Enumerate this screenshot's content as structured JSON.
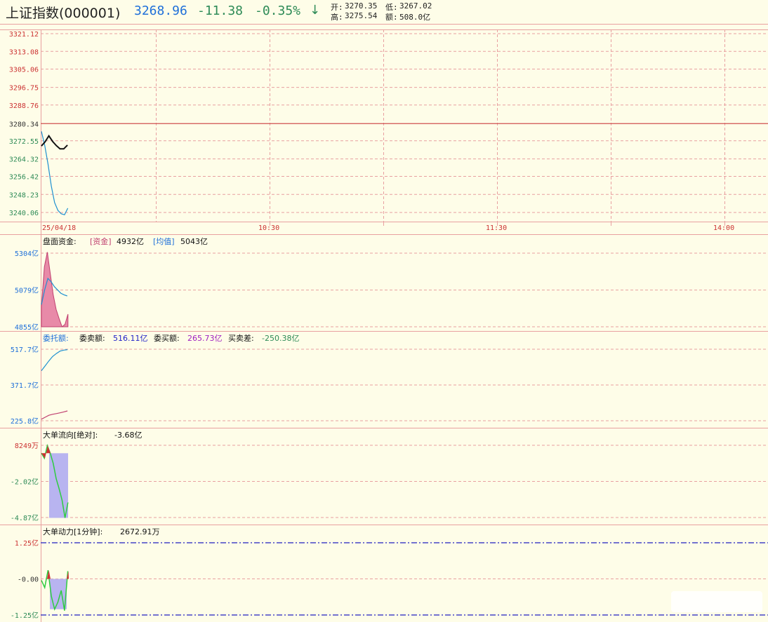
{
  "header": {
    "title": "上证指数(000001)",
    "price": "3268.96",
    "change": "-11.38",
    "change_pct": "-0.35%",
    "open_label": "开:",
    "open_value": "3270.35",
    "low_label": "低:",
    "low_value": "3267.02",
    "high_label": "高:",
    "high_value": "3275.54",
    "amount_label": "额:",
    "amount_value": "508.0亿"
  },
  "colors": {
    "up": "#cc3333",
    "down": "#2e8b57",
    "price_blue": "#1e6fd9",
    "grid": "#e8a0a0",
    "bg": "#fefde8"
  },
  "time_axis": {
    "labels": [
      "25/04/18",
      "10:30",
      "11:30",
      "14:00"
    ]
  },
  "panels": {
    "price": {
      "y_labels": [
        "3321.12",
        "3313.08",
        "3305.06",
        "3296.75",
        "3288.76",
        "3280.34",
        "3272.55",
        "3264.32",
        "3256.42",
        "3248.23",
        "3240.06"
      ],
      "prev_close": 3280.34
    },
    "capital": {
      "title": "盘面资金:",
      "fund_label": "[资金]",
      "fund_value": "4932亿",
      "avg_label": "[均值]",
      "avg_value": "5043亿",
      "y_labels": [
        "5304亿",
        "5079亿",
        "4855亿"
      ]
    },
    "orders": {
      "title": "委托额:",
      "sell_label": "委卖额:",
      "sell_value": "516.11亿",
      "buy_label": "委买额:",
      "buy_value": "265.73亿",
      "diff_label": "买卖差:",
      "diff_value": "-250.38亿",
      "y_labels": [
        "517.7亿",
        "371.7亿",
        "225.8亿"
      ]
    },
    "bigflow": {
      "title": "大单流向[绝对]:",
      "value": "-3.68亿",
      "y_labels": [
        "8249万",
        "-2.02亿",
        "-4.87亿"
      ]
    },
    "bigpower": {
      "title": "大单动力[1分钟]:",
      "value": "2672.91万",
      "y_labels": [
        "1.25亿",
        "-0.00",
        "-1.25亿"
      ]
    }
  },
  "chart_data": [
    {
      "type": "line",
      "title": "上证指数(000001)",
      "y_ticks": [
        3321.12,
        3313.08,
        3305.06,
        3296.75,
        3288.76,
        3280.34,
        3272.55,
        3264.32,
        3256.42,
        3248.23,
        3240.06
      ],
      "ylim": [
        3240.06,
        3321.12
      ],
      "x_labels": [
        "25/04/18",
        "10:30",
        "11:30",
        "14:00"
      ],
      "series": [
        {
          "values": [
            3270.2,
            3272.1,
            3274.8,
            3272.3,
            3270.4,
            3268.9,
            3268.9,
            3270.6
          ]
        },
        {
          "values": [
            3276.8,
            3270.5,
            3262.0,
            3252.0,
            3244.5,
            3241.0,
            3239.5,
            3239.0,
            3242.0
          ]
        }
      ]
    },
    {
      "type": "area",
      "title": "盘面资金",
      "ylim": [
        4855,
        5304
      ],
      "y_ticks": [
        5304,
        5079,
        4855
      ],
      "series": [
        {
          "name": "资金",
          "values": [
            4980,
            5220,
            5310,
            5180,
            5050,
            4960,
            4905,
            4855,
            4870,
            4932
          ]
        },
        {
          "name": "均值",
          "values": [
            4990,
            5080,
            5150,
            5130,
            5100,
            5080,
            5060,
            5050,
            5043
          ]
        }
      ]
    },
    {
      "type": "line",
      "title": "委托额",
      "ylim": [
        225.8,
        517.7
      ],
      "y_ticks": [
        517.7,
        371.7,
        225.8
      ],
      "series": [
        {
          "name": "委卖额",
          "values": [
            430,
            450,
            470,
            488,
            500,
            510,
            514,
            516.11
          ]
        },
        {
          "name": "委买额",
          "values": [
            232,
            240,
            248,
            252,
            255,
            258,
            262,
            265.73
          ]
        }
      ]
    },
    {
      "type": "area",
      "title": "大单流向[绝对]",
      "unit": "亿",
      "ylim": [
        -4.87,
        0.8249
      ],
      "y_ticks": [
        0.8249,
        -2.02,
        -4.87
      ],
      "series": [
        {
          "values": [
            0.2,
            -0.2,
            0.8,
            0.2,
            -0.6,
            -1.8,
            -2.6,
            -3.5,
            -4.9,
            -3.68
          ]
        }
      ]
    },
    {
      "type": "area",
      "title": "大单动力[1分钟]",
      "unit": "亿",
      "ylim": [
        -1.25,
        1.25
      ],
      "y_ticks": [
        1.25,
        0,
        -1.25
      ],
      "series": [
        {
          "values": [
            -0.05,
            -0.3,
            0.3,
            -0.6,
            -1.05,
            -0.8,
            -0.4,
            -1.1,
            0.27
          ]
        }
      ]
    }
  ]
}
